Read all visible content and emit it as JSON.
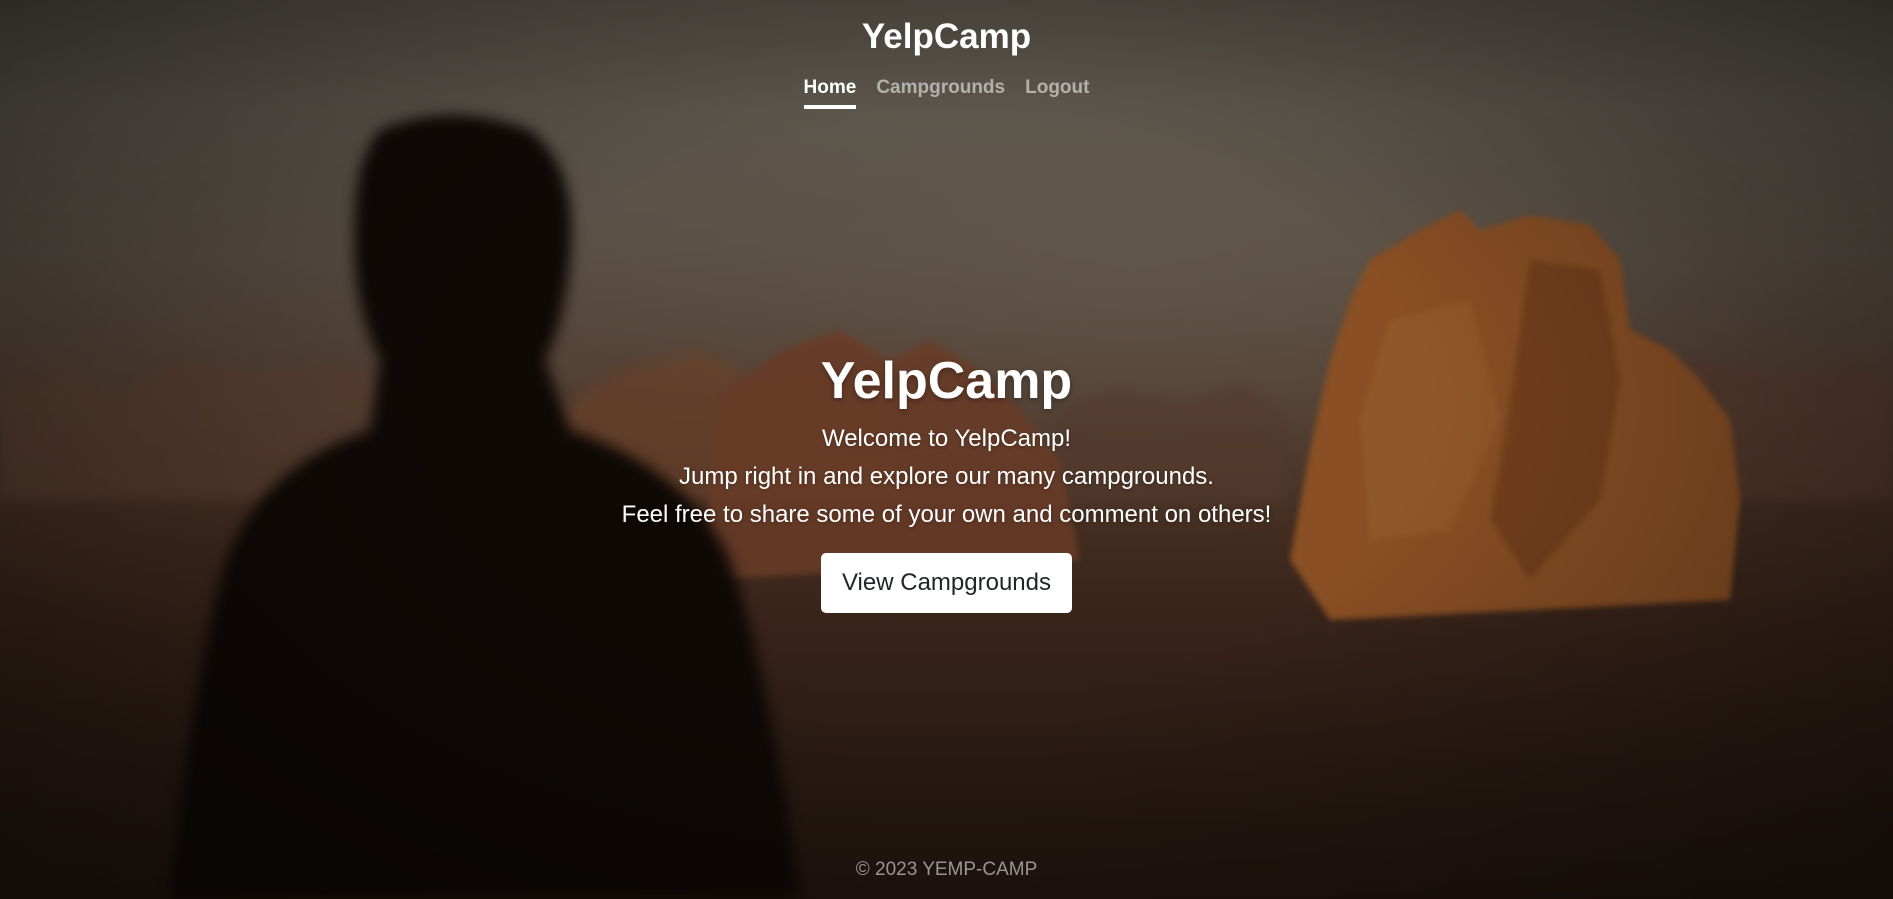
{
  "brand": "YelpCamp",
  "nav": {
    "home": "Home",
    "campgrounds": "Campgrounds",
    "logout": "Logout"
  },
  "hero": {
    "title": "YelpCamp",
    "line1": "Welcome to YelpCamp!",
    "line2": "Jump right in and explore our many campgrounds.",
    "line3": "Feel free to share some of your own and comment on others!",
    "button": "View Campgrounds"
  },
  "footer": {
    "copyright": "© 2023 YEMP-CAMP"
  },
  "colors": {
    "active_nav": "#ffffff",
    "inactive_nav": "rgba(255,255,255,0.55)",
    "button_bg": "#ffffff",
    "button_text": "#212529"
  }
}
